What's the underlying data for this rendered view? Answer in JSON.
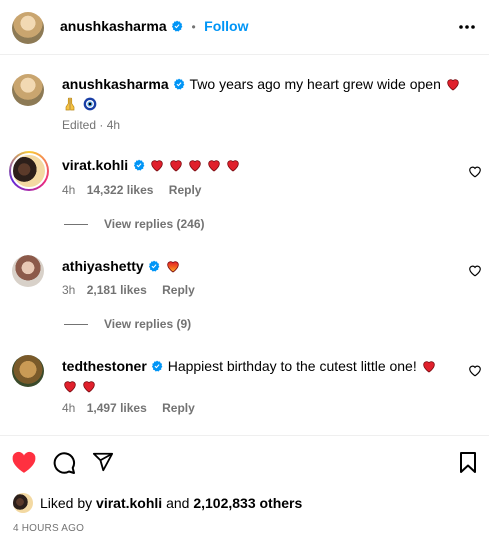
{
  "header": {
    "username": "anushkasharma",
    "separator": "•",
    "follow_label": "Follow",
    "more_icon": "more-horizontal-icon"
  },
  "caption": {
    "username": "anushkasharma",
    "text": "Two years ago my heart grew wide open",
    "emojis": [
      "red-heart",
      "folded-hands",
      "nazar-amulet"
    ],
    "edited": "Edited",
    "time": "4h"
  },
  "comments": [
    {
      "username": "virat.kohli",
      "hearts": 5,
      "time": "4h",
      "likes": "14,322 likes",
      "reply_label": "Reply",
      "view_replies": "View replies (246)"
    },
    {
      "username": "athiyashetty",
      "emoji": "heart-on-fire",
      "time": "3h",
      "likes": "2,181 likes",
      "reply_label": "Reply",
      "view_replies": "View replies (9)"
    },
    {
      "username": "tedthestoner",
      "text": "Happiest birthday to the cutest little one!",
      "hearts": 3,
      "time": "4h",
      "likes": "1,497 likes",
      "reply_label": "Reply"
    }
  ],
  "actions": {
    "like_icon": "heart-filled-icon",
    "comment_icon": "comment-icon",
    "share_icon": "share-icon",
    "save_icon": "bookmark-icon",
    "like_color": "#ff3040"
  },
  "liked_by": {
    "prefix": "Liked by",
    "user": "virat.kohli",
    "and": "and",
    "others": "2,102,833 others"
  },
  "timestamp": "4 HOURS AGO",
  "colors": {
    "accent": "#0095f6",
    "muted": "#737373",
    "heart": "#ed4956",
    "verified": "#0095f6"
  }
}
